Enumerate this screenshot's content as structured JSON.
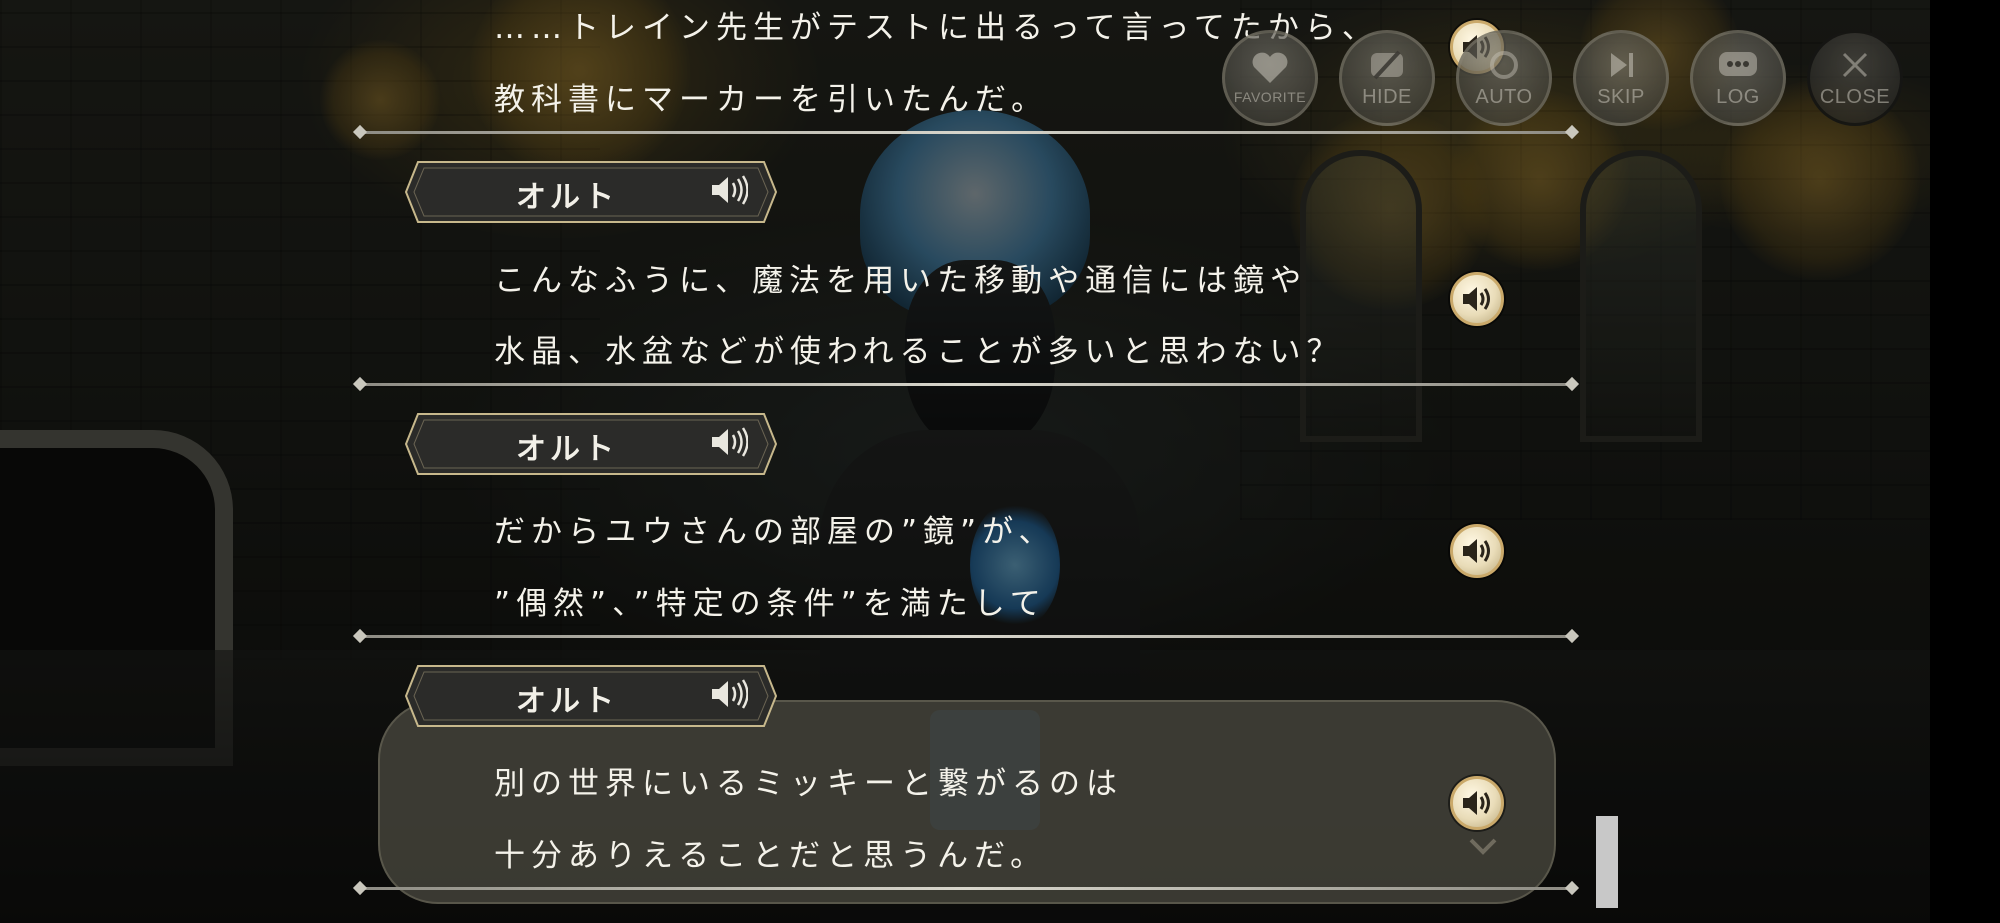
{
  "controls": [
    {
      "id": "favorite",
      "label": "FAVORITE",
      "icon": "heart-icon"
    },
    {
      "id": "hide",
      "label": "HIDE",
      "icon": "hide-icon"
    },
    {
      "id": "auto",
      "label": "AUTO",
      "icon": "auto-icon"
    },
    {
      "id": "skip",
      "label": "SKIP",
      "icon": "skip-icon"
    },
    {
      "id": "log",
      "label": "LOG",
      "icon": "log-icon"
    },
    {
      "id": "close",
      "label": "CLOSE",
      "icon": "close-icon"
    }
  ],
  "log": {
    "entries": [
      {
        "speaker": "",
        "lines": [
          "……トレイン先生がテストに出るって言ってたから、",
          "教科書にマーカーを引いたんだ。"
        ]
      },
      {
        "speaker": "オルト",
        "lines": [
          "こんなふうに、魔法を用いた移動や通信には鏡や",
          "水晶、水盆などが使われることが多いと思わない？"
        ]
      },
      {
        "speaker": "オルト",
        "lines": [
          "だからユウさんの部屋の”鏡”が、",
          "”偶然”、”特定の条件”を満たして"
        ]
      },
      {
        "speaker": "オルト",
        "lines": [
          "別の世界にいるミッキーと繋がるのは",
          "十分ありえることだと思うんだ。"
        ]
      }
    ]
  },
  "icons": {
    "speaker": "speaker-icon",
    "voice": "voice-play-icon",
    "more": "chevron-down-icon"
  },
  "colors": {
    "accent": "#caa96a",
    "text": "#f4f2ea",
    "nameplate": "#2b2b29"
  }
}
